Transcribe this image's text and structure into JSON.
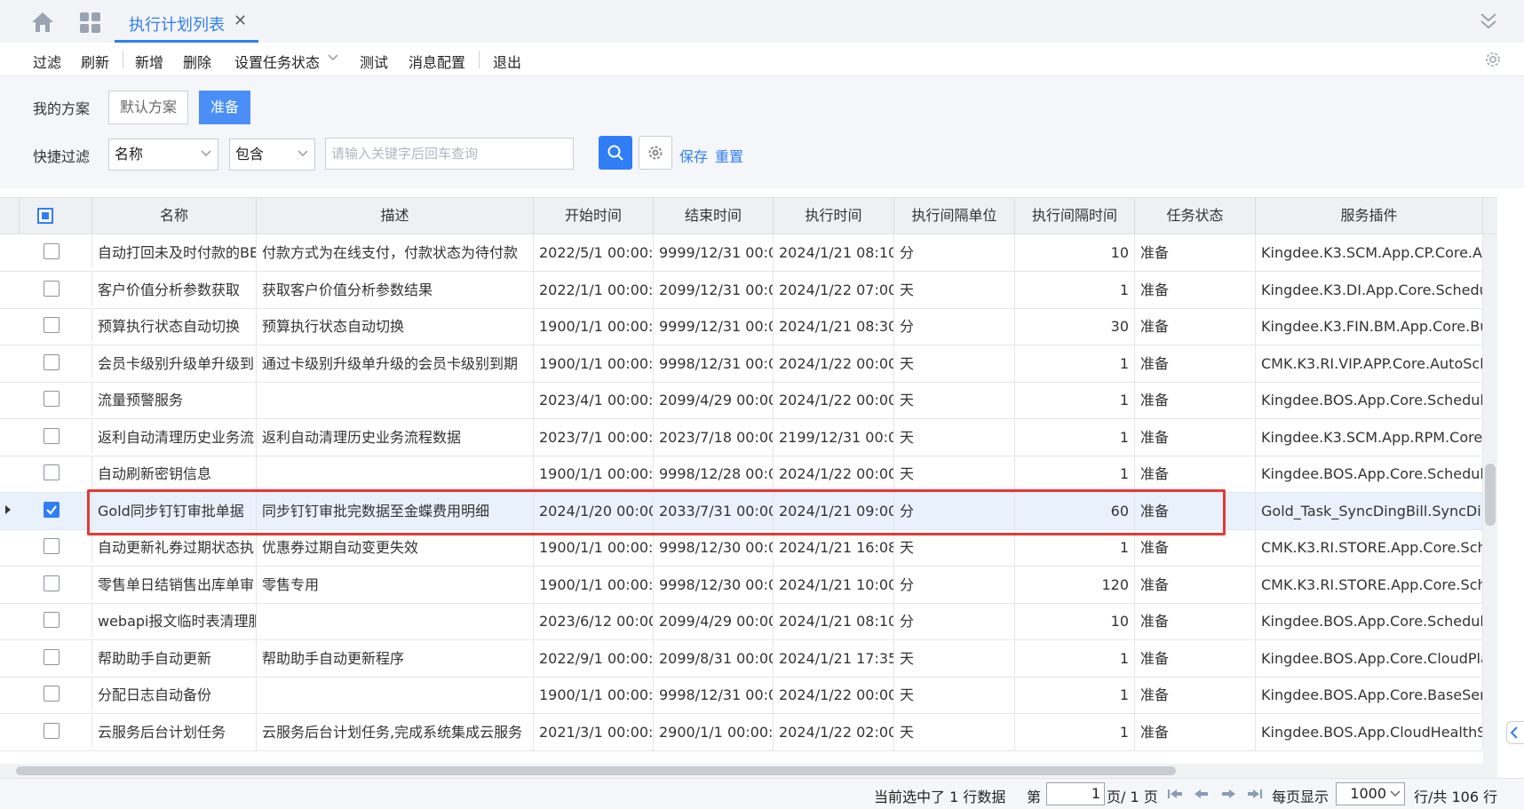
{
  "tabbar": {
    "active_tab": "执行计划列表",
    "close_glyph": "✕",
    "icons": [
      "home-icon",
      "apps-grid-icon",
      "collapse-chevrons-icon"
    ]
  },
  "toolbar": {
    "filter": "过滤",
    "refresh": "刷新",
    "add": "新增",
    "delete": "删除",
    "set_status": "设置任务状态",
    "test": "测试",
    "message_config": "消息配置",
    "exit": "退出"
  },
  "filter_panel": {
    "my_scheme_label": "我的方案",
    "scheme_default": "默认方案",
    "scheme_ready": "准备",
    "quick_filter_label": "快捷过滤",
    "field_select": "名称",
    "operator_select": "包含",
    "search_placeholder": "请输入关键字后回车查询",
    "save": "保存",
    "reset": "重置"
  },
  "grid": {
    "columns": [
      "名称",
      "描述",
      "开始时间",
      "结束时间",
      "执行时间",
      "执行间隔单位",
      "执行间隔时间",
      "任务状态",
      "服务插件"
    ],
    "rows": [
      {
        "name": "自动打回未及时付款的BE",
        "desc": "付款方式为在线支付，付款状态为待付款",
        "start": "2022/5/1 00:00:0",
        "end": "9999/12/31 00:0",
        "exec": "2024/1/21 08:10",
        "unit": "分",
        "interval": "10",
        "status": "准备",
        "plugin": "Kingdee.K3.SCM.App.CP.Core.Au",
        "checked": false
      },
      {
        "name": "客户价值分析参数获取",
        "desc": "获取客户价值分析参数结果",
        "start": "2022/1/1 00:00:0",
        "end": "2099/12/31 00:0",
        "exec": "2024/1/22 07:00",
        "unit": "天",
        "interval": "1",
        "status": "准备",
        "plugin": "Kingdee.K3.DI.App.Core.Schedul",
        "checked": false
      },
      {
        "name": "预算执行状态自动切换",
        "desc": "预算执行状态自动切换",
        "start": "1900/1/1 00:00:0",
        "end": "9999/12/31 00:0",
        "exec": "2024/1/21 08:30",
        "unit": "分",
        "interval": "30",
        "status": "准备",
        "plugin": "Kingdee.K3.FIN.BM.App.Core.Bu",
        "checked": false
      },
      {
        "name": "会员卡级别升级单升级到",
        "desc": "通过卡级别升级单升级的会员卡级别到期",
        "start": "1900/1/1 00:00:0",
        "end": "9998/12/31 00:0",
        "exec": "2024/1/22 00:00",
        "unit": "天",
        "interval": "1",
        "status": "准备",
        "plugin": "CMK.K3.RI.VIP.APP.Core.AutoSch",
        "checked": false
      },
      {
        "name": "流量预警服务",
        "desc": "",
        "start": "2023/4/1 00:00:0",
        "end": "2099/4/29 00:00",
        "exec": "2024/1/22 00:00",
        "unit": "天",
        "interval": "1",
        "status": "准备",
        "plugin": "Kingdee.BOS.App.Core.Schedule",
        "checked": false
      },
      {
        "name": "返利自动清理历史业务流",
        "desc": "返利自动清理历史业务流程数据",
        "start": "2023/7/1 00:00:0",
        "end": "2023/7/18 00:00",
        "exec": "2199/12/31 00:0",
        "unit": "天",
        "interval": "1",
        "status": "准备",
        "plugin": "Kingdee.K3.SCM.App.RPM.Core.",
        "checked": false
      },
      {
        "name": "自动刷新密钥信息",
        "desc": "",
        "start": "1900/1/1 00:00:0",
        "end": "9998/12/28 00:0",
        "exec": "2024/1/22 00:00",
        "unit": "天",
        "interval": "1",
        "status": "准备",
        "plugin": "Kingdee.BOS.App.Core.Schedule",
        "checked": false
      },
      {
        "name": "Gold同步钉钉审批单据",
        "desc": "同步钉钉审批完数据至金蝶费用明细",
        "start": "2024/1/20 00:00",
        "end": "2033/7/31 00:00",
        "exec": "2024/1/21 09:00",
        "unit": "分",
        "interval": "60",
        "status": "准备",
        "plugin": "Gold_Task_SyncDingBill.SyncDin",
        "checked": true
      },
      {
        "name": "自动更新礼券过期状态执",
        "desc": "优惠券过期自动变更失效",
        "start": "1900/1/1 00:00:0",
        "end": "9998/12/30 00:0",
        "exec": "2024/1/21 16:08",
        "unit": "天",
        "interval": "1",
        "status": "准备",
        "plugin": "CMK.K3.RI.STORE.App.Core.Sche",
        "checked": false
      },
      {
        "name": "零售单日结销售出库单审",
        "desc": "零售专用",
        "start": "1900/1/1 00:00:0",
        "end": "9998/12/30 00:0",
        "exec": "2024/1/21 10:00",
        "unit": "分",
        "interval": "120",
        "status": "准备",
        "plugin": "CMK.K3.RI.STORE.App.Core.Sche",
        "checked": false
      },
      {
        "name": "webapi报文临时表清理服",
        "desc": "",
        "start": "2023/6/12 00:00",
        "end": "2099/4/29 00:00",
        "exec": "2024/1/21 08:10",
        "unit": "分",
        "interval": "10",
        "status": "准备",
        "plugin": "Kingdee.BOS.App.Core.Schedule",
        "checked": false
      },
      {
        "name": "帮助助手自动更新",
        "desc": "帮助助手自动更新程序",
        "start": "2022/9/1 00:00:0",
        "end": "2099/8/31 00:00",
        "exec": "2024/1/21 17:35",
        "unit": "天",
        "interval": "1",
        "status": "准备",
        "plugin": "Kingdee.BOS.App.Core.CloudPla",
        "checked": false
      },
      {
        "name": "分配日志自动备份",
        "desc": "",
        "start": "1900/1/1 00:00:0",
        "end": "9998/12/31 00:0",
        "exec": "2024/1/22 00:00",
        "unit": "天",
        "interval": "1",
        "status": "准备",
        "plugin": "Kingdee.BOS.App.Core.BaseServ",
        "checked": false
      },
      {
        "name": "云服务后台计划任务",
        "desc": "云服务后台计划任务,完成系统集成云服务",
        "start": "2021/3/1 00:00:0",
        "end": "2900/1/1 00:00:0",
        "exec": "2024/1/22 02:00",
        "unit": "天",
        "interval": "1",
        "status": "准备",
        "plugin": "Kingdee.BOS.App.CloudHealthS",
        "checked": false
      }
    ]
  },
  "footer": {
    "selected_info": "当前选中了 1 行数据",
    "page_prefix": "第",
    "page_value": "1",
    "page_suffix": "页/ 1 页",
    "page_size_label": "每页显示",
    "page_size_value": "1000",
    "total_info": "行/共 106 行"
  },
  "colors": {
    "accent": "#2f7ef6",
    "highlight_border": "#e53935",
    "selected_row": "#e9f1fd"
  }
}
